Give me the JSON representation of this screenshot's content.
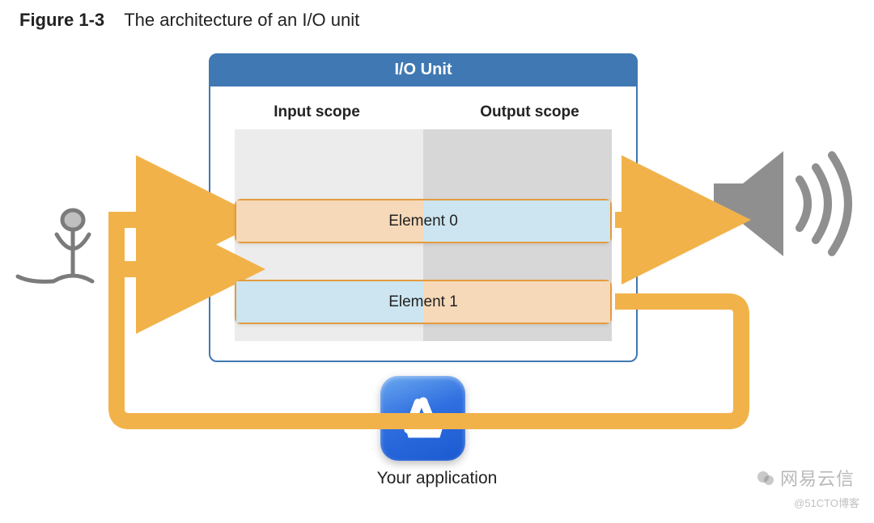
{
  "figure": {
    "prefix": "Figure 1-3",
    "title": "The architecture of an I/O unit"
  },
  "io_unit": {
    "header": "I/O Unit",
    "input_scope_label": "Input scope",
    "output_scope_label": "Output scope",
    "elements": [
      {
        "label": "Element 0",
        "left_color": "#F6D9B8",
        "right_color": "#CCE5F0"
      },
      {
        "label": "Element 1",
        "left_color": "#CCE5F0",
        "right_color": "#F6D9B8"
      }
    ]
  },
  "app_label": "Your application",
  "colors": {
    "frame_blue": "#3F78B3",
    "flow_orange": "#F2B24A",
    "scope_input_bg": "#ECECEC",
    "scope_output_bg": "#D7D7D7",
    "element_border": "#E49A3F",
    "speaker_gray": "#8F8F8F"
  },
  "icons": {
    "microphone": "microphone-icon",
    "speaker": "speaker-icon",
    "application": "app-store-style-icon"
  },
  "watermarks": {
    "primary": "网易云信",
    "secondary": "@51CTO博客"
  }
}
